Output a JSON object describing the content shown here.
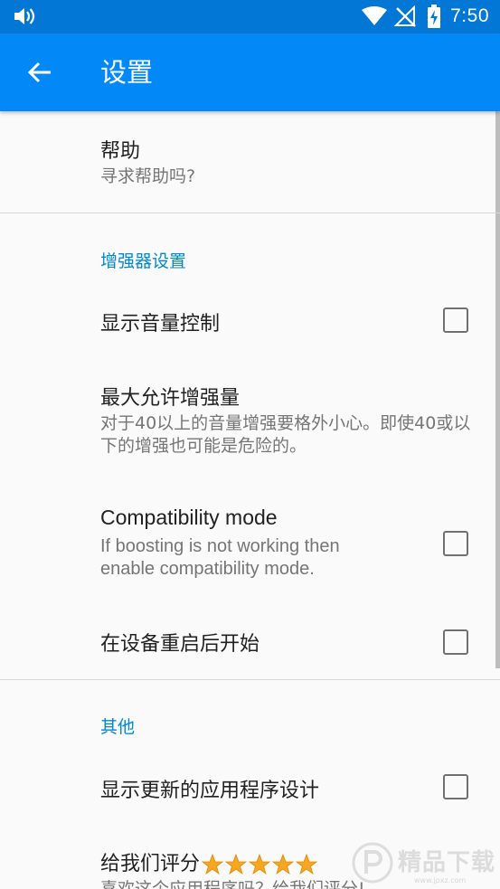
{
  "status_bar": {
    "time": "7:50",
    "icons": [
      "volume-icon",
      "wifi-icon",
      "no-signal-icon",
      "battery-charging-icon"
    ]
  },
  "app_bar": {
    "back_icon": "arrow-left-icon",
    "title": "设置"
  },
  "help": {
    "title": "帮助",
    "summary": "寻求帮助吗?"
  },
  "booster_category": {
    "label": "增强器设置",
    "items": [
      {
        "title": "显示音量控制",
        "checked": false
      },
      {
        "title": "最大允许增强量",
        "summary": "对于40以上的音量增强要格外小心。即使40或以下的增强也可能是危险的。"
      },
      {
        "title": "Compatibility mode",
        "summary": "If boosting is not working then enable compatibility mode.",
        "checked": false
      },
      {
        "title": "在设备重启后开始",
        "checked": false
      }
    ]
  },
  "other_category": {
    "label": "其他",
    "items": [
      {
        "title": "显示更新的应用程序设计",
        "checked": false
      },
      {
        "title": "给我们评分",
        "stars": 5,
        "summary": "喜欢这个应用程序吗？给我们评分!"
      }
    ]
  },
  "watermark": {
    "text": "精品下载",
    "url": "www.jpxz.com"
  },
  "colors": {
    "status_bar": "#0277d6",
    "app_bar": "#0288f7",
    "category_text": "#0288d1",
    "star": "#f5a623"
  }
}
